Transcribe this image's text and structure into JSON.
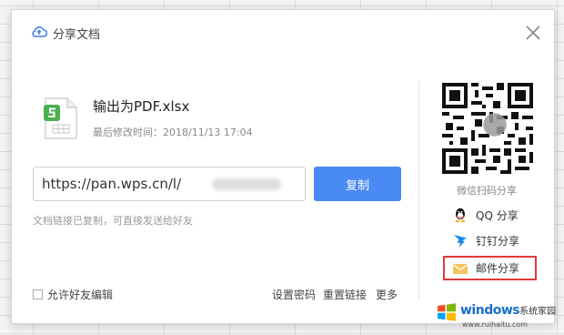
{
  "dialog": {
    "title": "分享文档",
    "close_icon": "close-icon",
    "cloud_icon": "cloud-share-icon"
  },
  "file": {
    "name": "输出为PDF.xlsx",
    "modified": "最后修改时间：2018/11/13 17:04",
    "icon": "spreadsheet-file-icon",
    "icon_color": "#4caf50"
  },
  "link": {
    "value": "https://pan.wps.cn/l/",
    "copy_label": "复制",
    "copied_note": "文档链接已复制，可直接发送给好友"
  },
  "options": {
    "allow_edit_label": "允许好友编辑",
    "allow_edit_checked": false,
    "set_password": "设置密码",
    "reset_link": "重置链接",
    "more": "更多"
  },
  "share": {
    "qr_caption": "微信扫码分享",
    "items": [
      {
        "label": "QQ 分享",
        "icon": "qq-penguin-icon"
      },
      {
        "label": "钉钉分享",
        "icon": "dingtalk-icon"
      },
      {
        "label": "邮件分享",
        "icon": "mail-envelope-icon",
        "highlighted": true
      }
    ]
  },
  "watermark": {
    "brand": "windows",
    "suffix": "系统家园",
    "url": "www.ruihaitu.com"
  },
  "colors": {
    "primary": "#4a8af4",
    "highlight_border": "#e03a3a",
    "watermark_blue": "#1a6fc9"
  }
}
